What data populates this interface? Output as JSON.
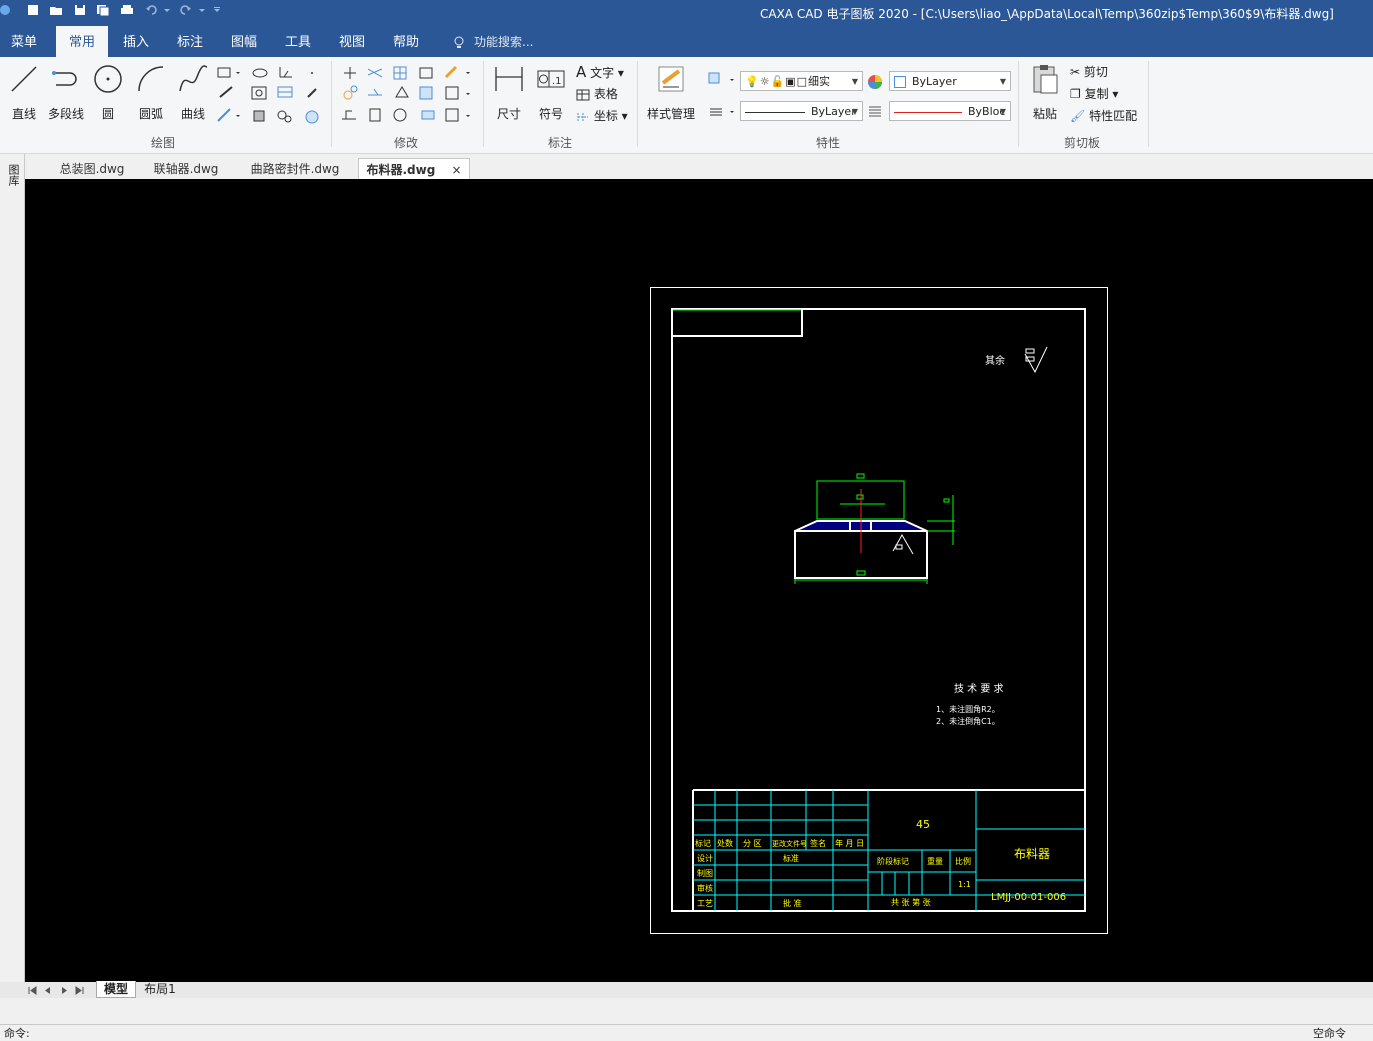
{
  "app": {
    "title": "CAXA CAD 电子图板 2020 - [C:\\Users\\liao_\\AppData\\Local\\Temp\\360zip$Temp\\360$9\\布料器.dwg]"
  },
  "menu": {
    "items": [
      {
        "label": "菜单"
      },
      {
        "label": "常用"
      },
      {
        "label": "插入"
      },
      {
        "label": "标注"
      },
      {
        "label": "图幅"
      },
      {
        "label": "工具"
      },
      {
        "label": "视图"
      },
      {
        "label": "帮助"
      }
    ],
    "search_placeholder": "功能搜索..."
  },
  "ribbon": {
    "draw": {
      "group_label": "绘图",
      "line": "直线",
      "polyline": "多段线",
      "circle": "圆",
      "arc": "圆弧",
      "curve": "曲线"
    },
    "modify": {
      "group_label": "修改"
    },
    "annotate": {
      "group_label": "标注",
      "dimension": "尺寸",
      "symbol": "符号",
      "text": "文字",
      "table": "表格",
      "coordinate": "坐标"
    },
    "properties": {
      "group_label": "特性",
      "style_manager": "样式管理",
      "layer_name": "细实",
      "color": "ByLayer",
      "linetype": "ByLayer",
      "lineweight": "ByBloc"
    },
    "clipboard": {
      "group_label": "剪切板",
      "paste": "粘贴",
      "cut": "剪切",
      "copy": "复制",
      "match_props": "特性匹配"
    }
  },
  "tabs": [
    {
      "label": "总装图.dwg"
    },
    {
      "label": "联轴器.dwg"
    },
    {
      "label": "曲路密封件.dwg"
    },
    {
      "label": "布料器.dwg",
      "active": true
    }
  ],
  "left_panel_label": "图库",
  "drawing": {
    "roughness_label": "其余",
    "tech_title": "技 术 要 求",
    "tech_notes": [
      "1、未注圆角R2。",
      "2、未注倒角C1。"
    ],
    "title_block": {
      "material": "45",
      "part_name": "布料器",
      "drawing_no": "LMJJ-00-01-006",
      "scale_value": "1:1",
      "headers": [
        "标记",
        "处数",
        "分 区",
        "更改文件号",
        "签名",
        "年 月 日"
      ],
      "rows": [
        "设计",
        "制图",
        "审核",
        "工艺"
      ],
      "standard": "标准",
      "approve": "批 准",
      "stage_mark": "阶段标记",
      "weight": "重量",
      "scale": "比例",
      "sheets": "共  张  第  张"
    }
  },
  "layout_tabs": [
    {
      "label": "模型",
      "active": true
    },
    {
      "label": "布局1"
    }
  ],
  "status": {
    "left": "命令:",
    "right": "空命令"
  },
  "colors": {
    "title_bar": "#2b5797",
    "canvas": "#000000",
    "frame": "#ffffff",
    "dim": "#00ff00",
    "table_line": "#00ffff",
    "table_text": "#ffff00"
  }
}
